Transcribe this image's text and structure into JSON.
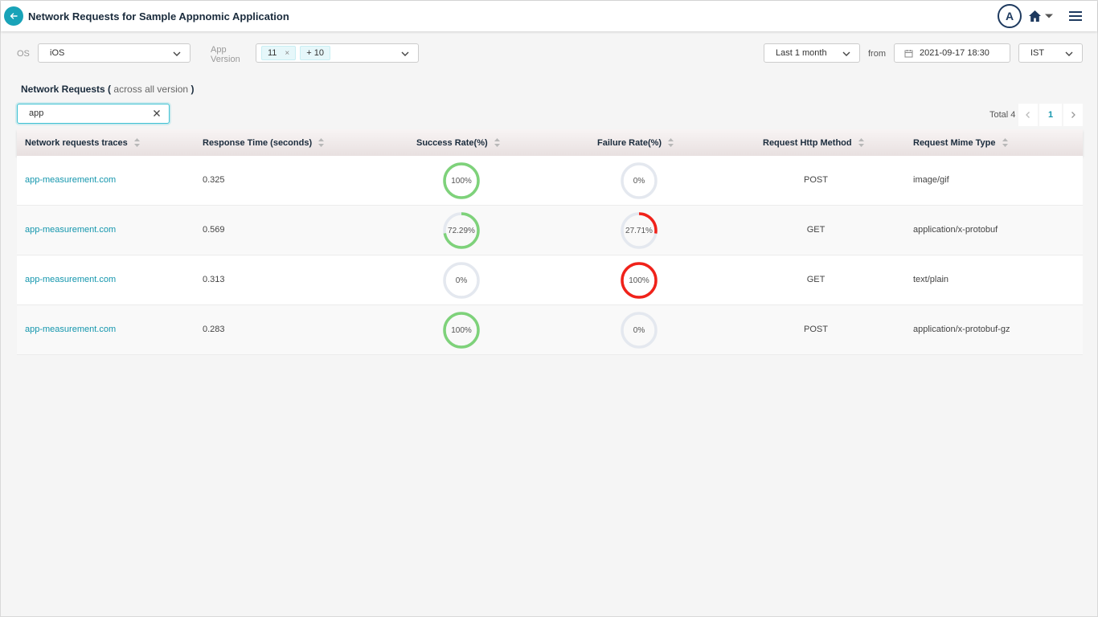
{
  "header": {
    "title": "Network Requests for Sample Appnomic Application",
    "avatar_initial": "A"
  },
  "filters": {
    "os_label": "OS",
    "os_value": "iOS",
    "app_version_label_1": "App",
    "app_version_label_2": "Version",
    "version_tags": [
      "11",
      "+ 10"
    ],
    "tag_remove": "×",
    "time_range": "Last 1 month",
    "from_label": "from",
    "from_date": "2021-09-17 18:30",
    "timezone": "IST"
  },
  "section": {
    "title": "Network Requests",
    "open_paren": "(",
    "subtitle": "across all version",
    "close_paren": ")"
  },
  "search": {
    "value": "app"
  },
  "pagination": {
    "total": "Total 4",
    "current_page": "1"
  },
  "columns": [
    "Network requests traces",
    "Response Time (seconds)",
    "Success Rate(%)",
    "Failure Rate(%)",
    "Request Http Method",
    "Request Mime Type"
  ],
  "rows": [
    {
      "trace": "app-measurement.com",
      "response_time": "0.325",
      "success_label": "100%",
      "success": 100,
      "failure_label": "0%",
      "failure": 0,
      "method": "POST",
      "mime": "image/gif"
    },
    {
      "trace": "app-measurement.com",
      "response_time": "0.569",
      "success_label": "72.29%",
      "success": 72.29,
      "failure_label": "27.71%",
      "failure": 27.71,
      "method": "GET",
      "mime": "application/x-protobuf"
    },
    {
      "trace": "app-measurement.com",
      "response_time": "0.313",
      "success_label": "0%",
      "success": 0,
      "failure_label": "100%",
      "failure": 100,
      "method": "GET",
      "mime": "text/plain"
    },
    {
      "trace": "app-measurement.com",
      "response_time": "0.283",
      "success_label": "100%",
      "success": 100,
      "failure_label": "0%",
      "failure": 0,
      "method": "POST",
      "mime": "application/x-protobuf-gz"
    }
  ],
  "colors": {
    "accent": "#19a3b8",
    "link": "#1496ad",
    "success": "#7ed27a",
    "failure": "#f0221a",
    "ring_track": "#e4e8ef"
  },
  "icons": {
    "back": "arrow-left-icon",
    "home": "home-icon",
    "menu": "hamburger-menu-icon",
    "calendar": "calendar-icon",
    "clear": "close-icon",
    "sort": "sort-icon"
  }
}
